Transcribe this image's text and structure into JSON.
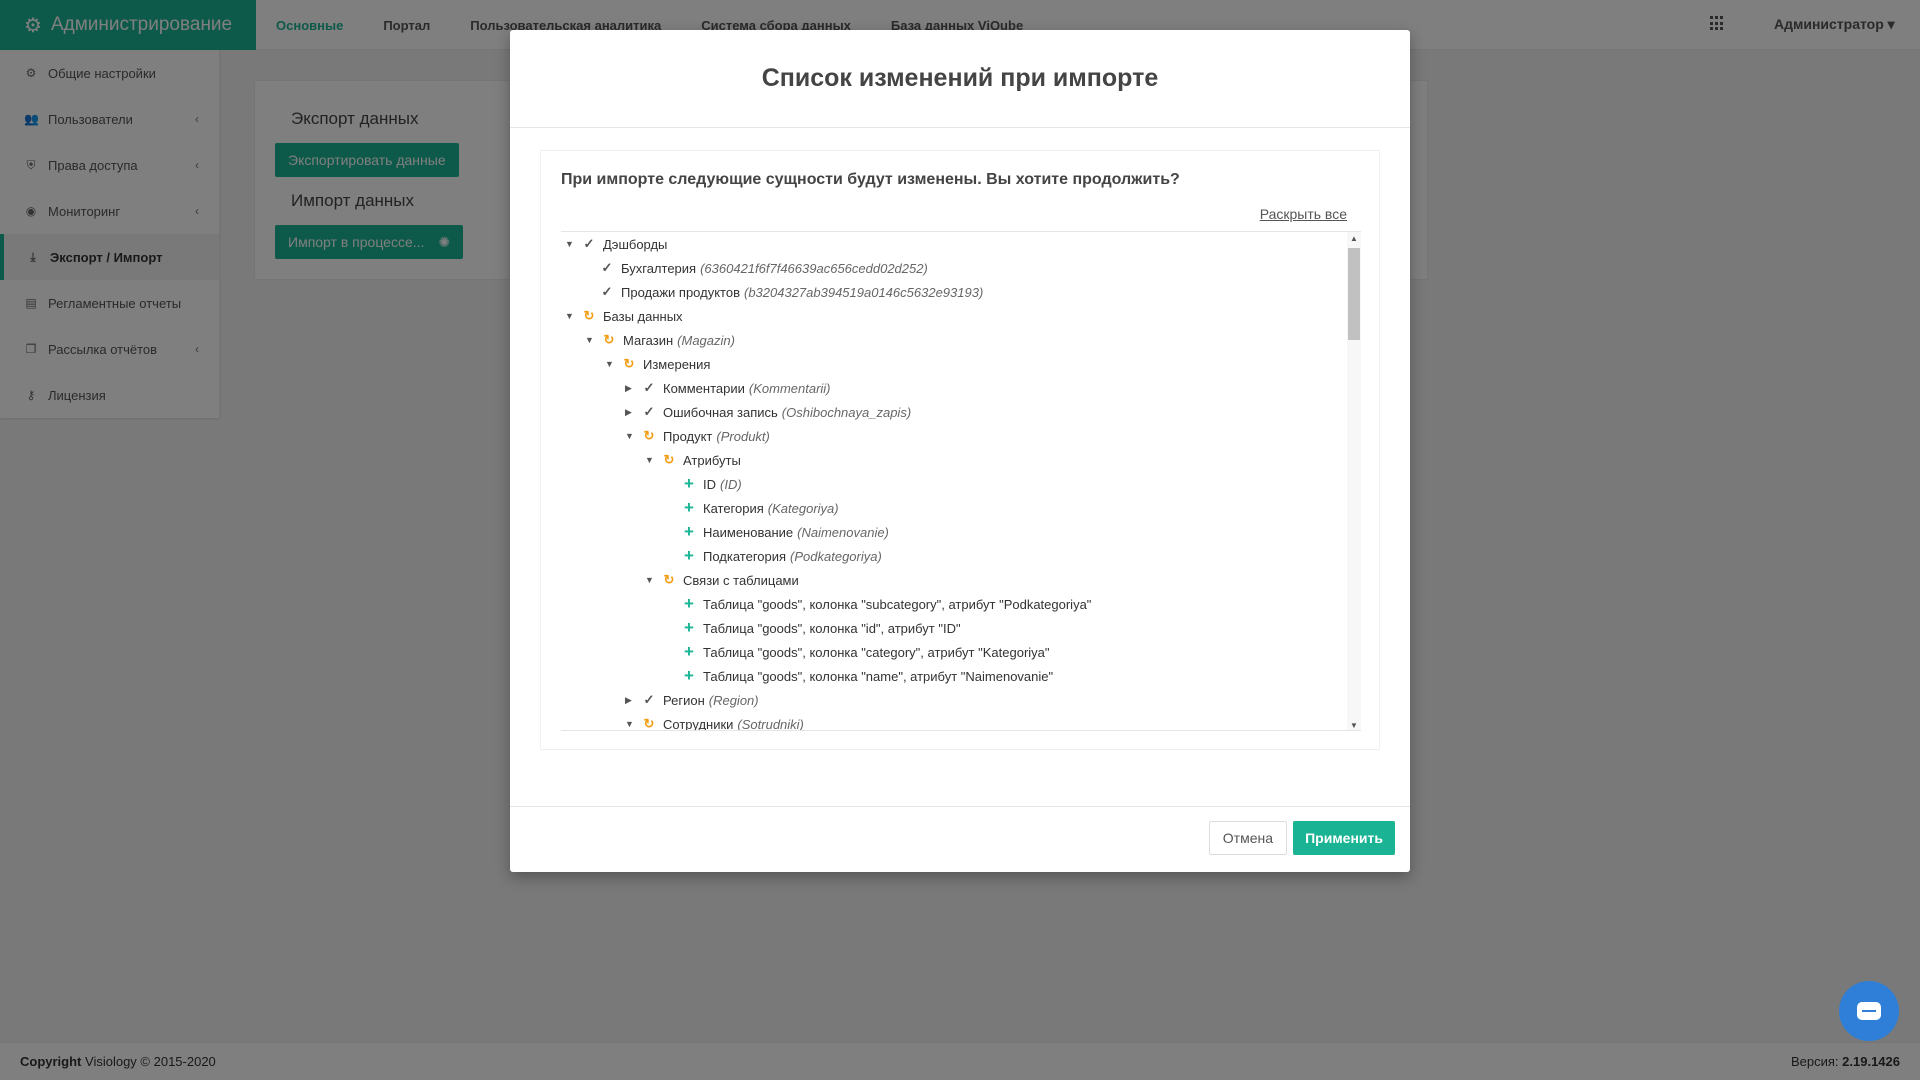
{
  "app": {
    "title": "Администрирование"
  },
  "topnav": {
    "items": [
      {
        "label": "Основные",
        "active": true
      },
      {
        "label": "Портал"
      },
      {
        "label": "Пользовательская аналитика"
      },
      {
        "label": "Система сбора данных"
      },
      {
        "label": "База данных ViQube"
      }
    ],
    "user": "Администратор"
  },
  "sidebar": {
    "items": [
      {
        "label": "Общие настройки",
        "icon": "gear-icon"
      },
      {
        "label": "Пользователи",
        "icon": "users-icon"
      },
      {
        "label": "Права доступа",
        "icon": "shield-icon"
      },
      {
        "label": "Мониторинг",
        "icon": "monitor-icon"
      },
      {
        "label": "Экспорт / Импорт",
        "icon": "download-icon",
        "active": true
      },
      {
        "label": "Регламентные отчеты",
        "icon": "report-icon"
      },
      {
        "label": "Рассылка отчётов",
        "icon": "copy-icon"
      },
      {
        "label": "Лицензия",
        "icon": "key-icon"
      }
    ]
  },
  "content": {
    "export_title": "Экспорт данных",
    "export_button": "Экспортировать данные",
    "import_title": "Импорт данных",
    "import_button": "Импорт в процессе..."
  },
  "footer": {
    "copyright_label": "Copyright",
    "copyright_text": "Visiology © 2015-2020",
    "version_label": "Версия:",
    "version": "2.19.1426"
  },
  "modal": {
    "title": "Список изменений при импорте",
    "question": "При импорте следующие сущности будут изменены. Вы хотите продолжить?",
    "expand_all": "Раскрыть все",
    "cancel": "Отмена",
    "apply": "Применить",
    "tree": [
      {
        "name": "Дэшборды",
        "en": ""
      },
      {
        "name": "Бухгалтерия",
        "en": "(6360421f6f7f46639ac656cedd02d252)"
      },
      {
        "name": "Продажи продуктов",
        "en": "(b3204327ab394519a0146c5632e93193)"
      },
      {
        "name": "Базы данных",
        "en": ""
      },
      {
        "name": "Магазин",
        "en": "(Magazin)"
      },
      {
        "name": "Измерения",
        "en": ""
      },
      {
        "name": "Комментарии",
        "en": "(Kommentarii)"
      },
      {
        "name": "Ошибочная запись",
        "en": "(Oshibochnaya_zapis)"
      },
      {
        "name": "Продукт",
        "en": "(Produkt)"
      },
      {
        "name": "Атрибуты",
        "en": ""
      },
      {
        "name": "ID",
        "en": "(ID)"
      },
      {
        "name": "Категория",
        "en": "(Kategoriya)"
      },
      {
        "name": "Наименование",
        "en": "(Naimenovanie)"
      },
      {
        "name": "Подкатегория",
        "en": "(Podkategoriya)"
      },
      {
        "name": "Связи с таблицами",
        "en": ""
      },
      {
        "name": "Таблица \"goods\", колонка \"subcategory\", атрибут \"Podkategoriya\"",
        "en": ""
      },
      {
        "name": "Таблица \"goods\", колонка \"id\", атрибут \"ID\"",
        "en": ""
      },
      {
        "name": "Таблица \"goods\", колонка \"category\", атрибут \"Kategoriya\"",
        "en": ""
      },
      {
        "name": "Таблица \"goods\", колонка \"name\", атрибут \"Naimenovanie\"",
        "en": ""
      },
      {
        "name": "Регион",
        "en": "(Region)"
      },
      {
        "name": "Сотрудники",
        "en": "(Sotrudniki)"
      }
    ]
  }
}
